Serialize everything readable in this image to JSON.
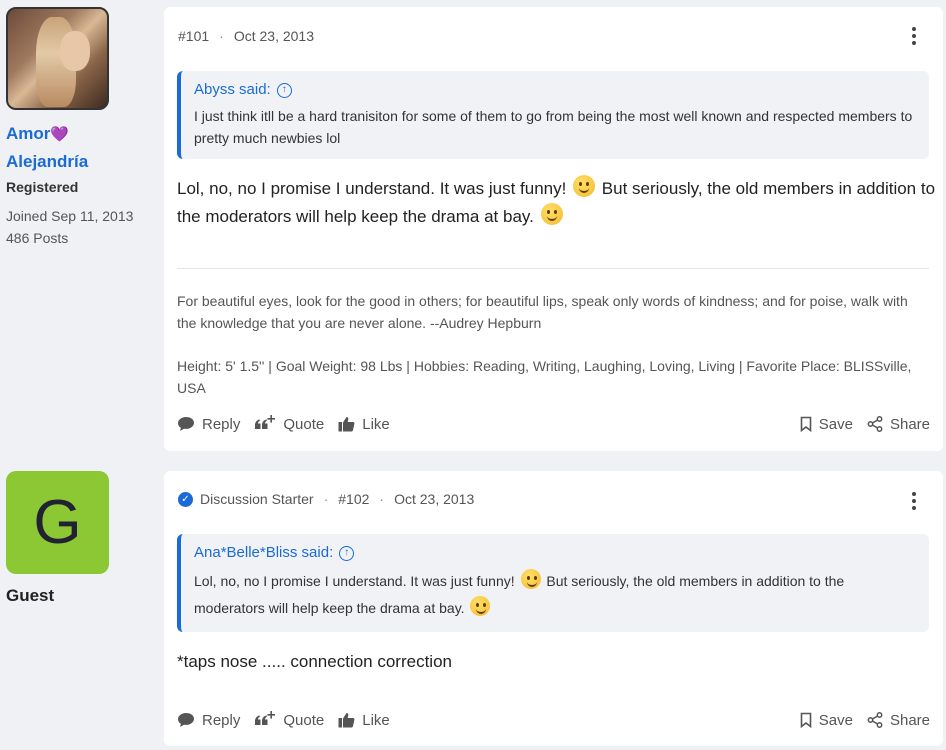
{
  "posts": [
    {
      "user": {
        "name_line1": "Amor",
        "name_heart": "💜",
        "name_line2": "Alejandría",
        "role": "Registered",
        "joined": "Joined Sep 11, 2013",
        "posts": "486 Posts"
      },
      "number": "#101",
      "date": "Oct 23, 2013",
      "quote": {
        "author": "Abyss said:",
        "text": "I just think itll be a hard tranisiton for some of them to go from being the most well known and respected members to pretty much newbies lol"
      },
      "body_part1": "Lol, no, no I promise I understand. It was just funny!",
      "body_part2": "But seriously, the old members in addition to the moderators will help keep the drama at bay.",
      "signature": {
        "quote": "For beautiful eyes, look for the good in others; for beautiful lips, speak only words of kindness; and for poise, walk with the knowledge that you are never alone. --Audrey Hepburn",
        "info": "Height: 5' 1.5'' | Goal Weight: 98 Lbs | Hobbies: Reading, Writing, Laughing, Loving, Living | Favorite Place: BLISSville, USA"
      }
    },
    {
      "user": {
        "avatar_letter": "G",
        "name": "Guest"
      },
      "badge": "Discussion Starter",
      "number": "#102",
      "date": "Oct 23, 2013",
      "quote": {
        "author": "Ana*Belle*Bliss said:",
        "text_part1": "Lol, no, no I promise I understand. It was just funny!",
        "text_part2": "But seriously, the old members in addition to the moderators will help keep the drama at bay."
      },
      "body": "*taps nose ..... connection correction"
    }
  ],
  "actions": {
    "reply": "Reply",
    "quote": "Quote",
    "like": "Like",
    "save": "Save",
    "share": "Share"
  },
  "colors": {
    "link": "#1a6bd6",
    "guest_avatar": "#8bc834",
    "background": "#f0f1f4"
  }
}
